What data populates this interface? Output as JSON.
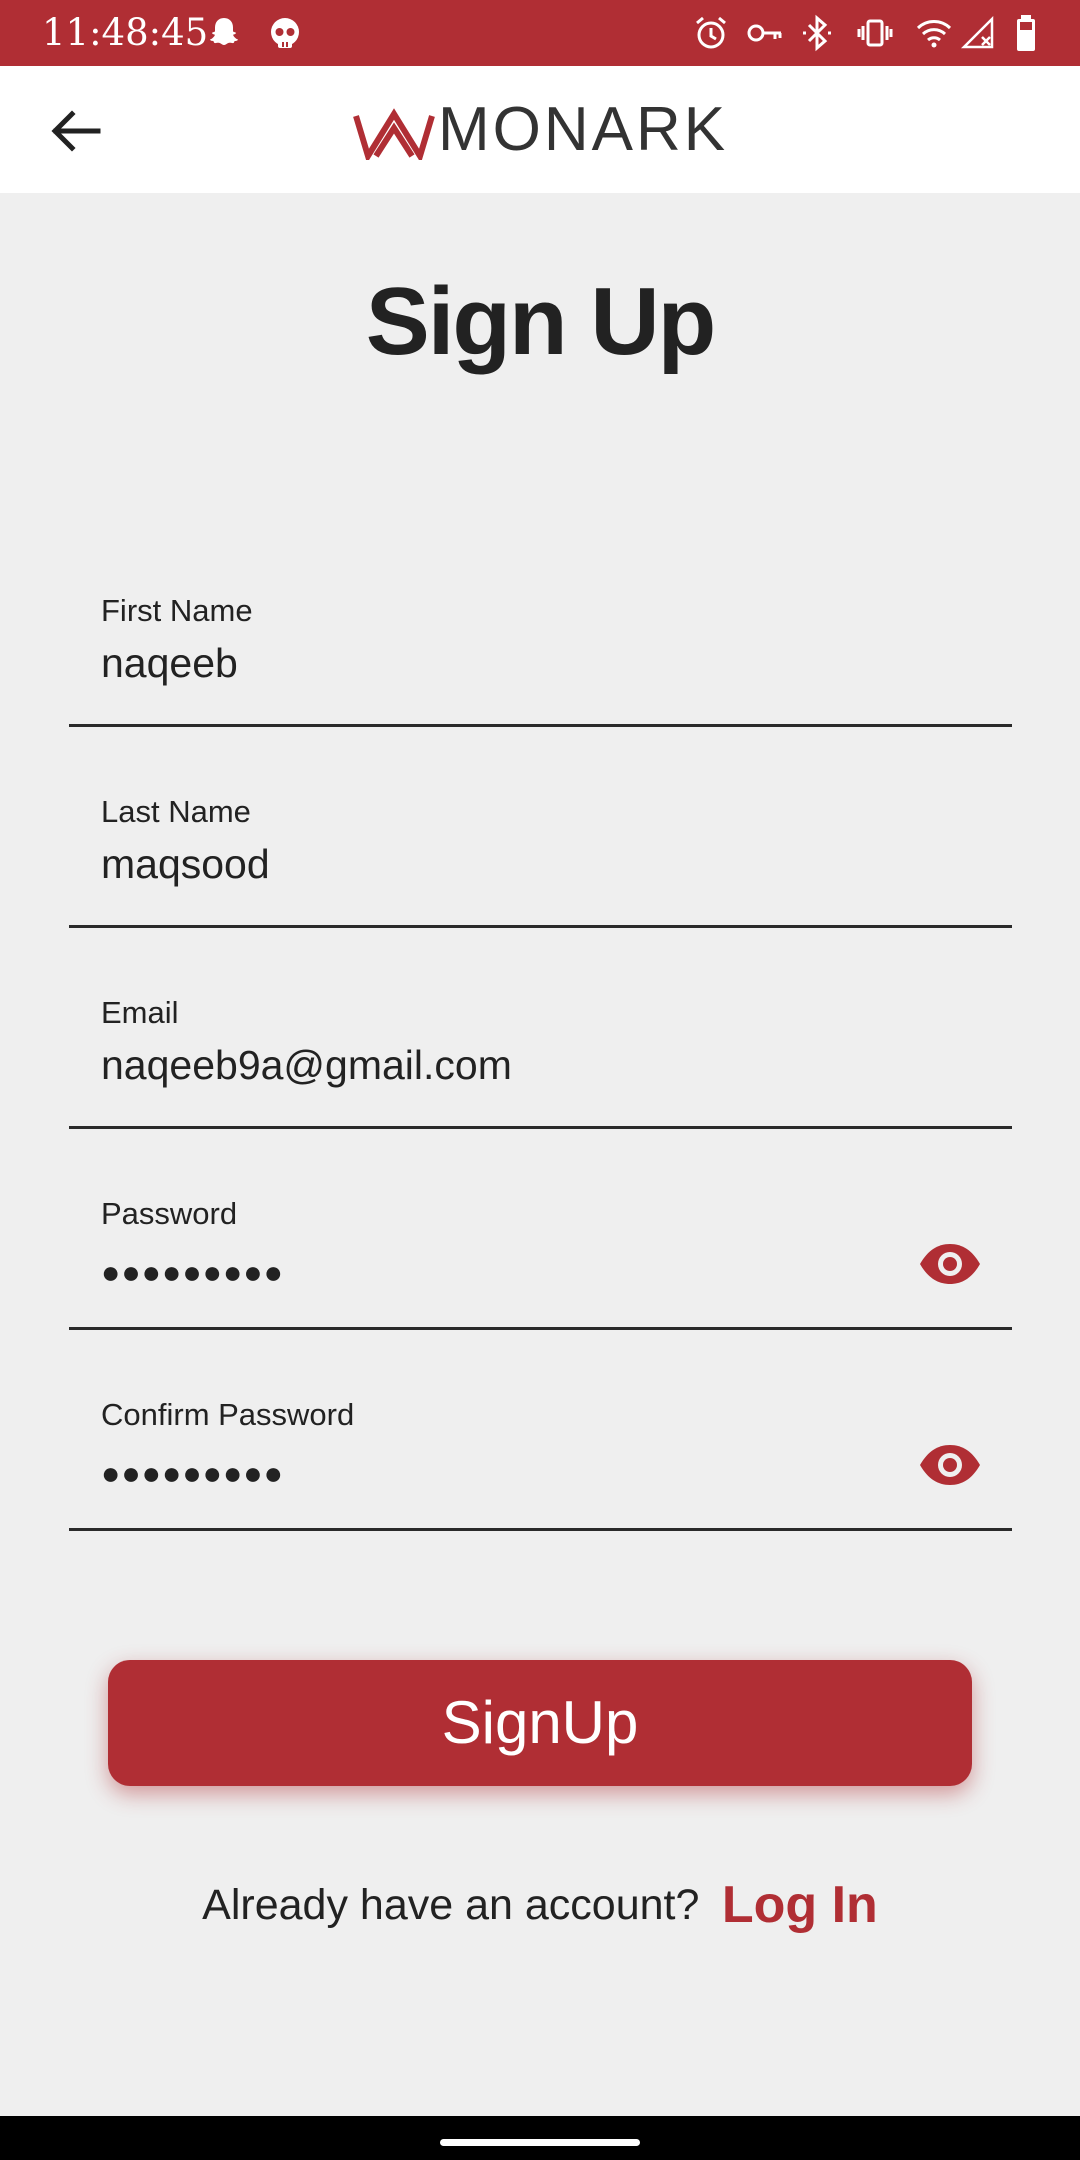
{
  "status_bar": {
    "time": "11:48:45",
    "left_icons": [
      "snapchat-ghost-icon",
      "skull-icon"
    ],
    "right_icons": [
      "alarm-icon",
      "vpn-key-icon",
      "bluetooth-icon",
      "vibrate-icon",
      "wifi-icon",
      "signal-no-service-icon",
      "battery-icon"
    ]
  },
  "app_bar": {
    "back_icon": "arrow-left-icon",
    "logo_text": "MONARK"
  },
  "page": {
    "title": "Sign Up"
  },
  "form": {
    "first_name": {
      "label": "First Name",
      "value": "naqeeb"
    },
    "last_name": {
      "label": "Last Name",
      "value": "maqsood"
    },
    "email": {
      "label": "Email",
      "value": "naqeeb9a@gmail.com"
    },
    "password": {
      "label": "Password",
      "masked_value": "●●●●●●●●●",
      "toggle_icon": "eye-icon"
    },
    "confirm_password": {
      "label": "Confirm Password",
      "masked_value": "●●●●●●●●●",
      "toggle_icon": "eye-icon"
    }
  },
  "actions": {
    "signup_label": "SignUp",
    "login_prompt": "Already have an account?",
    "login_link": "Log In"
  },
  "colors": {
    "brand_red": "#b02e34",
    "background": "#efefef",
    "text": "#222222"
  }
}
